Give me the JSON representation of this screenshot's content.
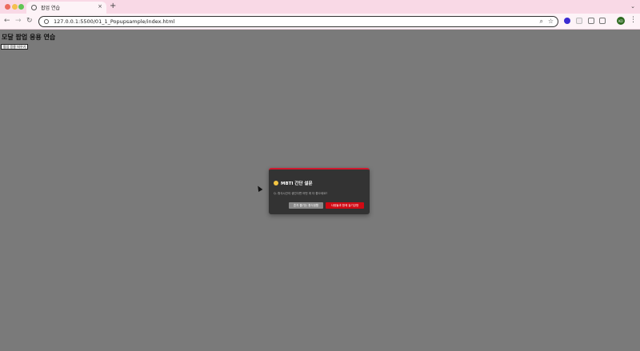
{
  "browser": {
    "tab_title": "팝업 연습",
    "tab_close": "×",
    "new_tab": "+",
    "tab_dropdown": "⌄",
    "nav_back": "←",
    "nav_forward": "→",
    "nav_reload": "↻",
    "url": "127.0.0.1:5500/01_1_Popupsample/index.html",
    "zoom_icon_glyph": "⌕",
    "star_icon_glyph": "☆",
    "profile_initials": "KO",
    "menu_glyph": "⋮"
  },
  "page": {
    "title": "모달 팝업 응용 연습",
    "open_button_label": "팝업 응용 띄우기"
  },
  "modal": {
    "title": "MBTI 간단 설문",
    "question": "Q. 휴식시간이 생긴다면 어떤 게 더 좋으세요?",
    "option_introvert": "혼자 즐기는 휴식생활",
    "option_extrovert": "사람들과 함께 놀기강방"
  },
  "colors": {
    "tabstrip": "#f9d9e6",
    "overlay": "#7a7a7a",
    "modal_bg": "#333333",
    "modal_accent": "#d0192e",
    "grey_button": "#8a8a8a",
    "red_button": "#d00a14"
  },
  "icons": {
    "tab_favicon": "globe-icon",
    "info": "info-icon",
    "zoom": "zoom-icon",
    "bookmark": "star-icon",
    "modal_emoji": "thinking-face-icon"
  }
}
